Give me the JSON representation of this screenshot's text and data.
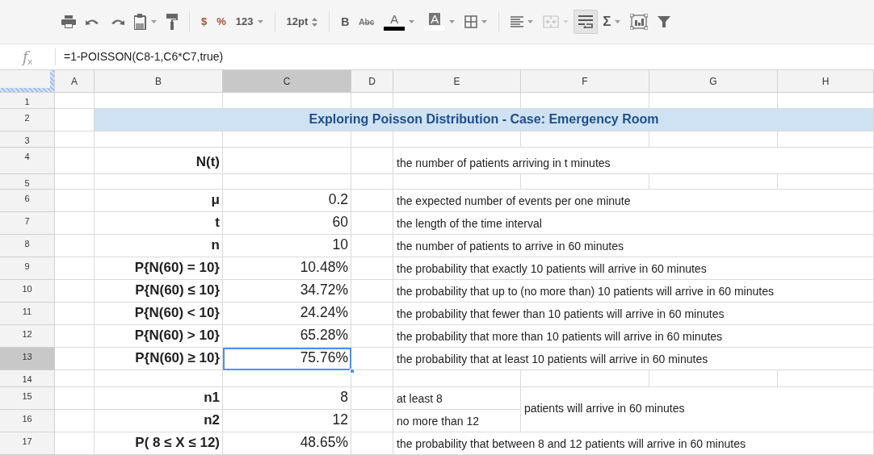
{
  "toolbar": [
    {
      "kind": "icon",
      "menu": false,
      "disabled": false,
      "pressed": false
    },
    {
      "kind": "icon",
      "menu": false,
      "disabled": false,
      "pressed": false
    },
    {
      "kind": "icon",
      "menu": false,
      "disabled": false,
      "pressed": false
    },
    {
      "kind": "icon",
      "menu": true,
      "disabled": false,
      "pressed": false
    },
    {
      "kind": "icon",
      "menu": false,
      "disabled": false,
      "pressed": false
    },
    {
      "kind": "separator"
    },
    {
      "kind": "currency",
      "text": "$",
      "menu": false,
      "disabled": false,
      "pressed": false
    },
    {
      "kind": "currency",
      "text": "%",
      "menu": false,
      "disabled": false,
      "pressed": false
    },
    {
      "kind": "text",
      "text": "123",
      "menu": true,
      "disabled": false,
      "pressed": false
    },
    {
      "kind": "separator"
    },
    {
      "kind": "size",
      "text": "12pt",
      "menu": false,
      "disabled": false,
      "pressed": false
    },
    {
      "kind": "separator"
    },
    {
      "kind": "bold",
      "text": "B",
      "menu": false,
      "disabled": false,
      "pressed": false
    },
    {
      "kind": "strike",
      "text": "Abc",
      "menu": false,
      "disabled": false,
      "pressed": false
    },
    {
      "kind": "swatch",
      "text": "A",
      "color": "#000000",
      "menu": true,
      "disabled": false,
      "pressed": false
    },
    {
      "kind": "fill",
      "text": "A",
      "color": "#ffffff",
      "menu": true,
      "disabled": false,
      "pressed": false
    },
    {
      "kind": "icon",
      "menu": true,
      "disabled": false,
      "pressed": false
    },
    {
      "kind": "separator"
    },
    {
      "kind": "icon",
      "menu": true,
      "disabled": false,
      "pressed": false
    },
    {
      "kind": "icon",
      "menu": true,
      "disabled": true,
      "pressed": false
    },
    {
      "kind": "icon",
      "menu": false,
      "disabled": false,
      "pressed": true
    },
    {
      "kind": "text",
      "text": "Σ",
      "menu": true,
      "disabled": false,
      "pressed": false
    },
    {
      "kind": "icon",
      "menu": false,
      "disabled": false,
      "pressed": false
    },
    {
      "kind": "icon",
      "menu": false,
      "disabled": false,
      "pressed": false
    }
  ],
  "formula_bar": {
    "label": "*f*$_{x}$",
    "formula": "=1-POISSON(C8-1,C6*C7,true)"
  },
  "columns": [
    {
      "label": "A",
      "selected": false
    },
    {
      "label": "B",
      "selected": false
    },
    {
      "label": "C",
      "selected": true
    },
    {
      "label": "D",
      "selected": false
    },
    {
      "label": "E",
      "selected": false
    },
    {
      "label": "F",
      "selected": false
    },
    {
      "label": "G",
      "selected": false
    },
    {
      "label": "H",
      "selected": false
    }
  ],
  "rows": [
    {
      "number": "1",
      "selected": false
    },
    {
      "number": "2",
      "selected": false,
      "title": "Exploring Poisson Distribution - Case: Emergency Room"
    },
    {
      "number": "3",
      "selected": false
    },
    {
      "number": "4",
      "selected": false,
      "label": "N(t)",
      "description": "the number of patients arriving in t minutes"
    },
    {
      "number": "5",
      "selected": false
    },
    {
      "number": "6",
      "selected": false,
      "label": "μ",
      "value": "0.2",
      "description": "the expected number of events per one minute"
    },
    {
      "number": "7",
      "selected": false,
      "label": "t",
      "value": "60",
      "description": "the length of the time interval"
    },
    {
      "number": "8",
      "selected": false,
      "label": "n",
      "value": "10",
      "description": "the number of patients to arrive in 60 minutes"
    },
    {
      "number": "9",
      "selected": false,
      "label": "P{N(60) = 10}",
      "value": "10.48%",
      "description": "the probability that exactly 10 patients will arrive in 60 minutes"
    },
    {
      "number": "10",
      "selected": false,
      "label": "P{N(60) ≤ 10}",
      "value": "34.72%",
      "description": "the probability that up to (no more than) 10 patients will arrive in 60 minutes"
    },
    {
      "number": "11",
      "selected": false,
      "label": "P{N(60) < 10}",
      "value": "24.24%",
      "description": "the probability that fewer than 10 patients will arrive in 60 minutes"
    },
    {
      "number": "12",
      "selected": false,
      "label": "P{N(60) > 10}",
      "value": "65.28%",
      "description": "the probability that more than 10 patients will arrive in 60 minutes"
    },
    {
      "number": "13",
      "selected": true,
      "label": "P{N(60) ≥ 10}",
      "value": "75.76%",
      "description": "the probability that at least 10 patients will arrive in 60 minutes"
    },
    {
      "number": "14",
      "selected": false
    },
    {
      "number": "15",
      "selected": false,
      "label": "n1",
      "value": "8",
      "description": "at least 8",
      "note": "patients will arrive in 60 minutes"
    },
    {
      "number": "16",
      "selected": false,
      "label": "n2",
      "value": "12",
      "description": "no more than 12"
    },
    {
      "number": "17",
      "selected": false,
      "label": "P( 8 ≤ X ≤ 12)",
      "value": "48.65%",
      "description": "the probability that between 8 and 12 patients will arrive in 60 minutes"
    }
  ]
}
